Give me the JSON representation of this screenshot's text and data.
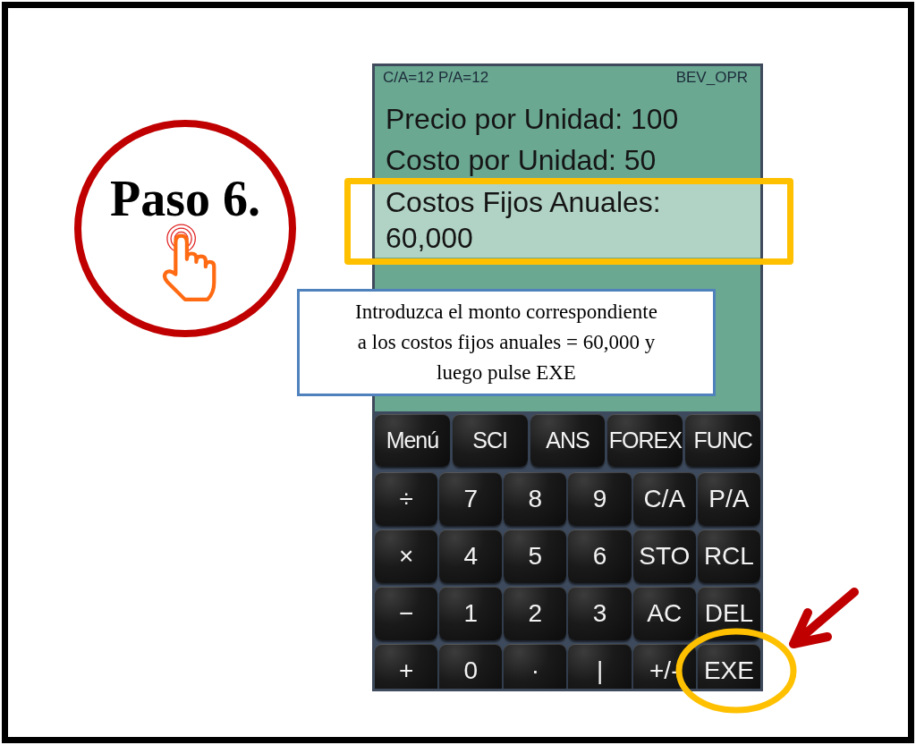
{
  "step_badge": {
    "label": "Paso 6."
  },
  "phone": {
    "status": {
      "rates": "C/A=12 P/A=12",
      "mode": "BEV_OPR"
    },
    "display_lines": [
      {
        "text": "Precio por Unidad: 100",
        "selected": false
      },
      {
        "text": "Costo por Unidad: 50",
        "selected": false
      },
      {
        "text": "Costos Fijos Anuales: 60,000",
        "selected": true
      }
    ],
    "keypad": [
      {
        "keys": [
          "Menú",
          "SCI",
          "ANS",
          "FOREX",
          "FUNC"
        ]
      },
      {
        "keys": [
          "÷",
          "7",
          "8",
          "9",
          "C/A",
          "P/A"
        ]
      },
      {
        "keys": [
          "×",
          "4",
          "5",
          "6",
          "STO",
          "RCL"
        ]
      },
      {
        "keys": [
          "−",
          "1",
          "2",
          "3",
          "AC",
          "DEL"
        ]
      },
      {
        "keys": [
          "+",
          "0",
          "·",
          "|",
          "+/-",
          "EXE"
        ]
      }
    ]
  },
  "callout": {
    "lines": [
      "Introduzca el monto correspondiente",
      "a los costos fijos anuales = 60,000 y",
      "luego pulse EXE"
    ]
  }
}
